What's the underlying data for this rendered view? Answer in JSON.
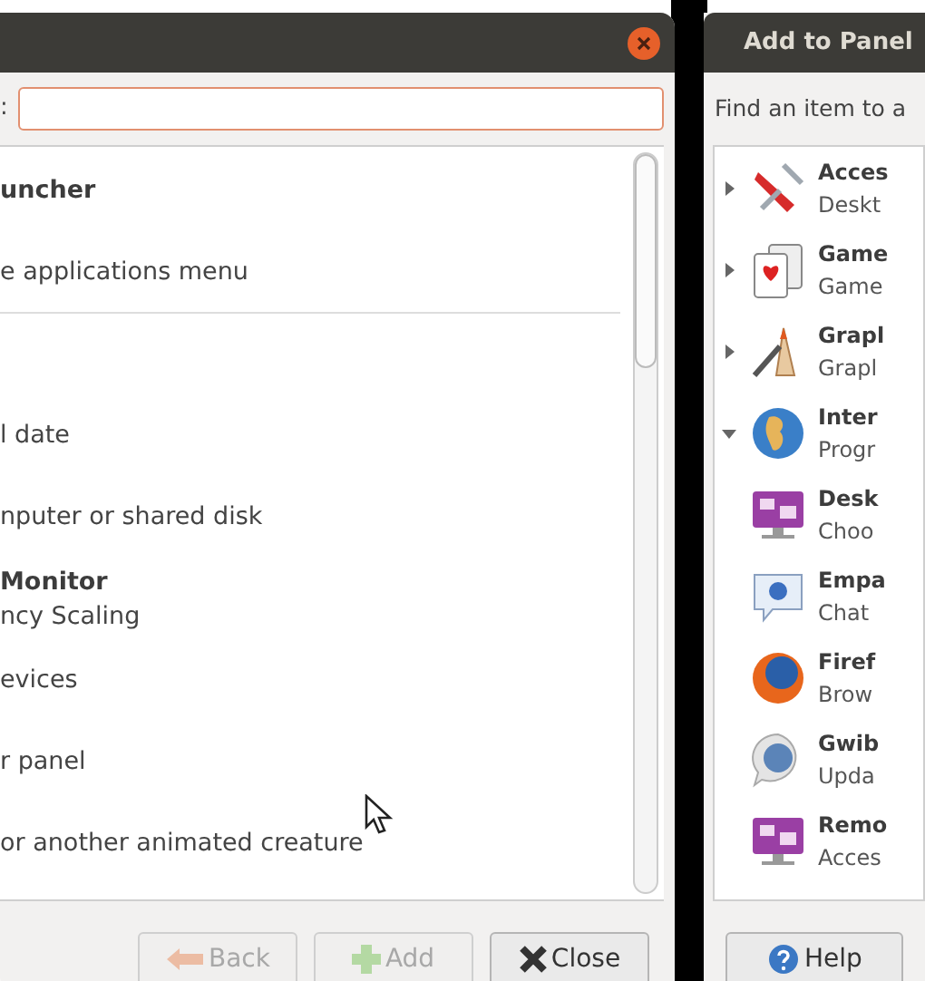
{
  "left_window": {
    "field_label": ":",
    "items": [
      {
        "title": "uncher",
        "divider_below": false
      },
      {
        "description": "e applications menu",
        "divider_below": true
      },
      {
        "divider_below": false
      },
      {
        "description": "l date",
        "divider_below": false
      },
      {
        "description": "nputer or shared disk",
        "divider_below": false
      },
      {
        "title": "Monitor",
        "description": "ncy Scaling",
        "divider_below": false
      },
      {
        "description": "evices",
        "divider_below": false
      },
      {
        "description": "r panel",
        "divider_below": false
      },
      {
        "description": "or another animated creature",
        "divider_below": false
      }
    ],
    "buttons": [
      {
        "label": "Back",
        "kind": "back",
        "disabled": true
      },
      {
        "label": "Add",
        "kind": "add",
        "disabled": true
      },
      {
        "label": "Close",
        "kind": "close",
        "disabled": false
      }
    ]
  },
  "right_window": {
    "title": "Add to Panel",
    "prompt": "Find an item to a",
    "items": [
      {
        "name": "Acces",
        "description": "Deskt",
        "kind": "knife",
        "expanded": false
      },
      {
        "name": "Game",
        "description": "Game",
        "kind": "cards",
        "expanded": false
      },
      {
        "name": "Grapl",
        "description": "Grapl",
        "kind": "brush",
        "expanded": false
      },
      {
        "name": "Inter",
        "description": "Progr",
        "kind": "globe",
        "expanded": true,
        "children": [
          {
            "name": "Desk",
            "description": "Choo",
            "kind": "monitor"
          },
          {
            "name": "Empa",
            "description": "Chat",
            "kind": "chat"
          },
          {
            "name": "Firef",
            "description": "Brow",
            "kind": "browser"
          },
          {
            "name": "Gwib",
            "description": "Upda",
            "kind": "bubble"
          },
          {
            "name": "Remo",
            "description": "Acces",
            "kind": "monitor"
          }
        ]
      }
    ]
  },
  "help_button": "Help"
}
